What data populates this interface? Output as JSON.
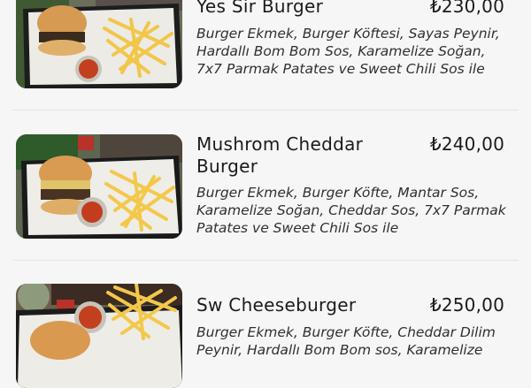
{
  "menu": {
    "items": [
      {
        "name": "Yes Sir Burger",
        "price": "₺230,00",
        "description": "Burger Ekmek, Burger Köftesi, Sayas Peynir, Hardallı Bom Bom Sos, Karamelize Soğan, 7x7 Parmak Patates ve Sweet Chili Sos ile"
      },
      {
        "name": "Mushrom Cheddar Burger",
        "price": "₺240,00",
        "description": "Burger Ekmek, Burger Köfte, Mantar Sos, Karamelize Soğan, Cheddar Sos, 7x7 Parmak Patates ve Sweet Chili Sos ile"
      },
      {
        "name": "Sw Cheeseburger",
        "price": "₺250,00",
        "description": "Burger Ekmek, Burger Köfte, Cheddar Dilim Peynir, Hardallı Bom Bom sos, Karamelize"
      }
    ]
  }
}
